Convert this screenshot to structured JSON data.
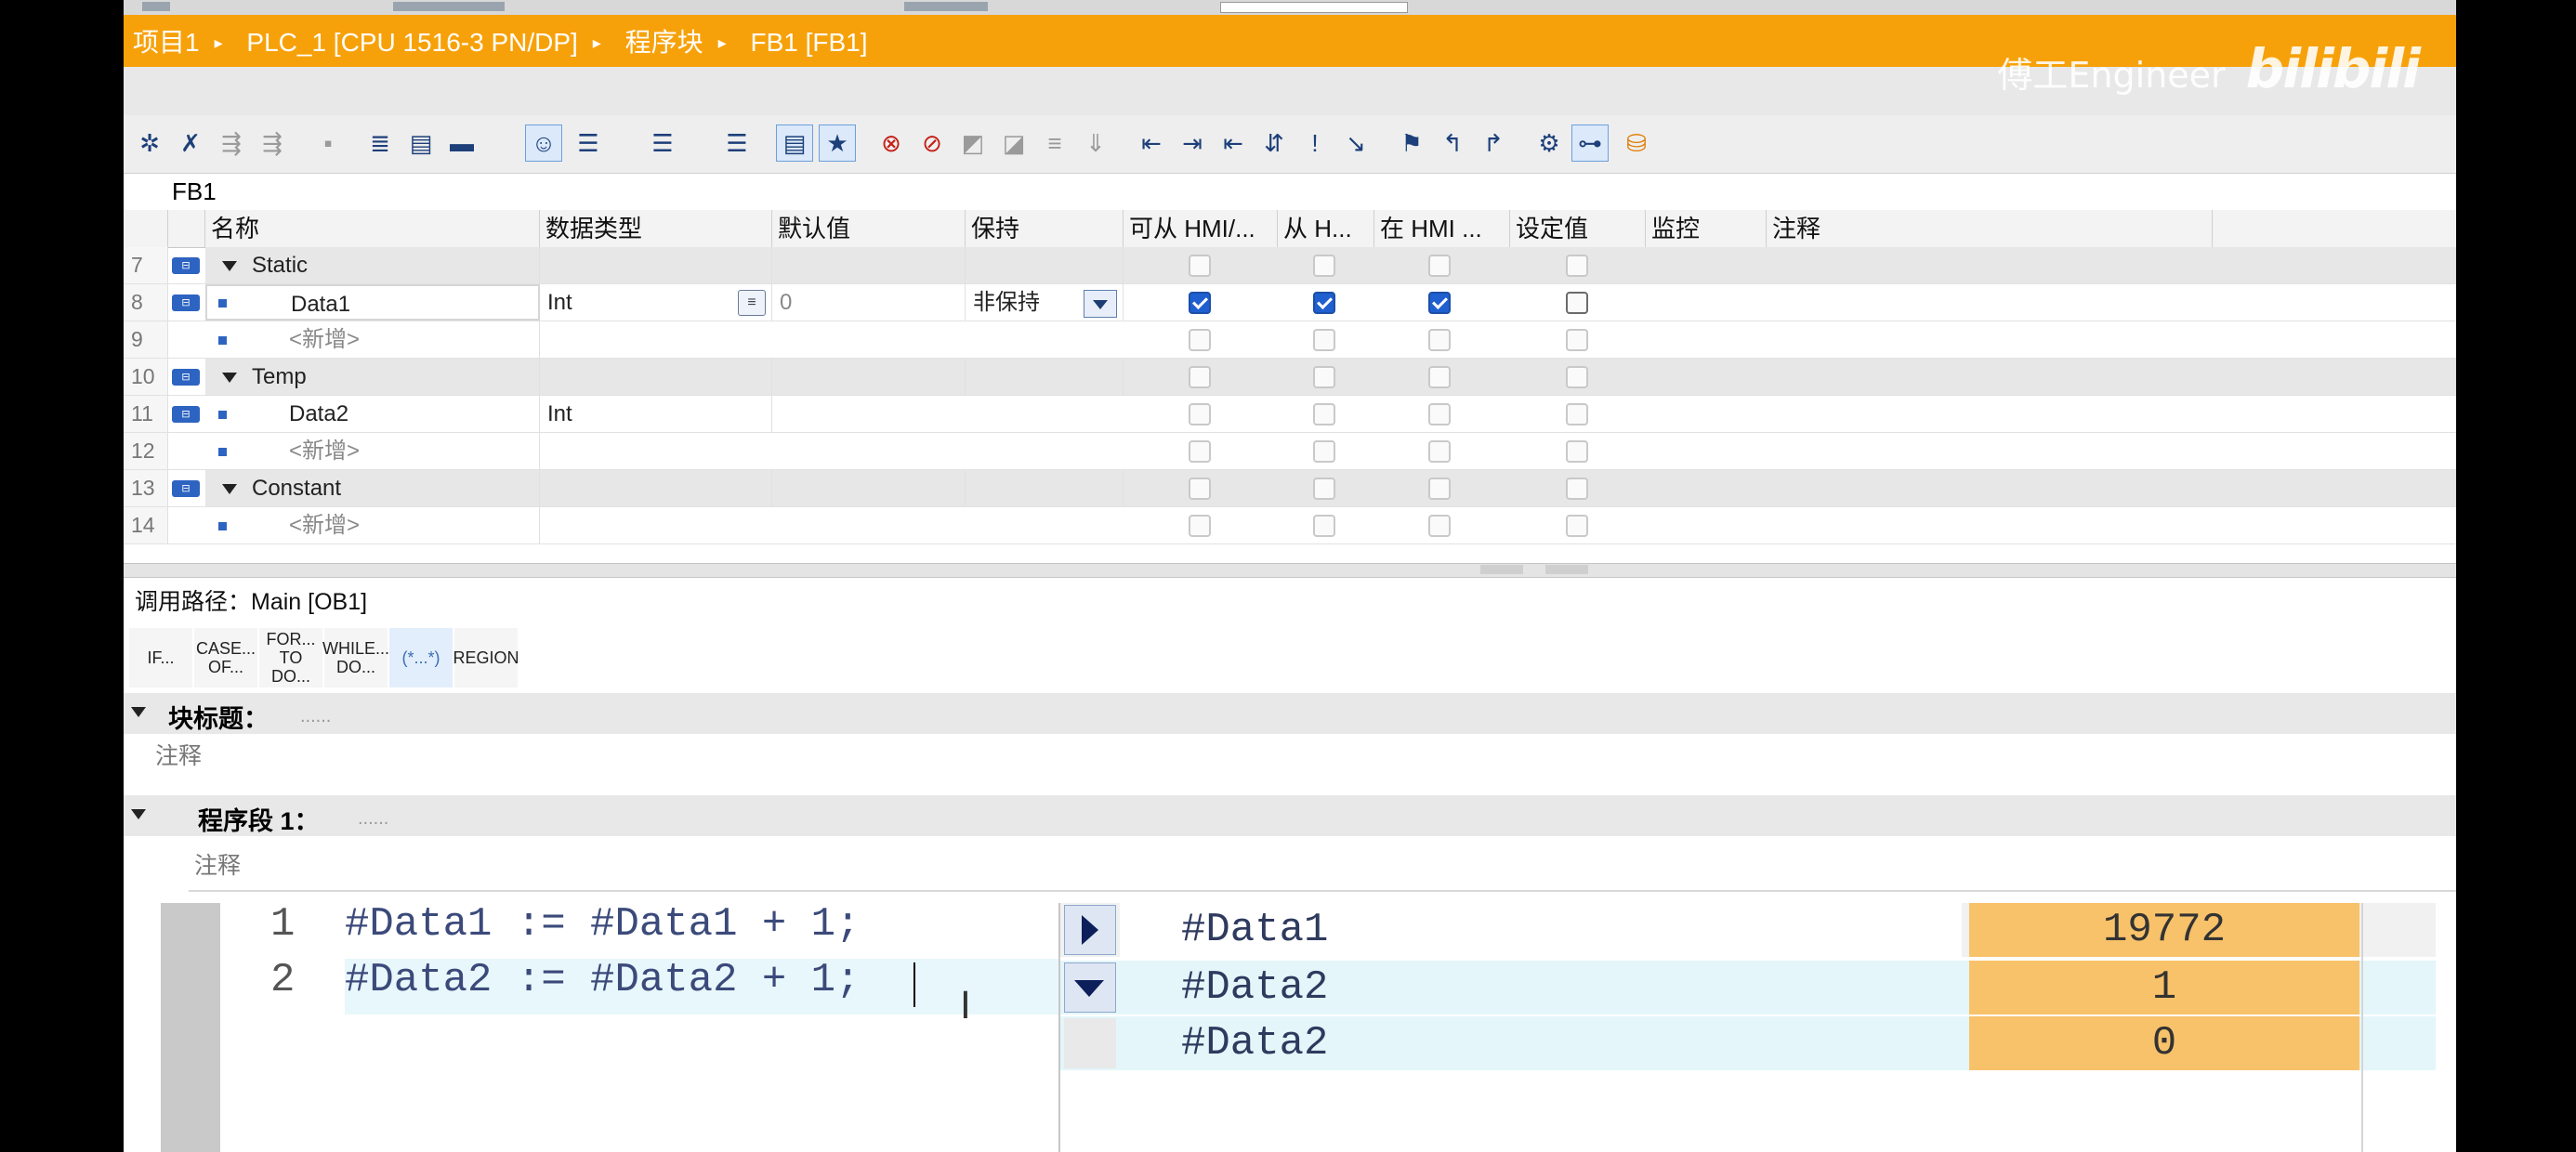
{
  "breadcrumb": {
    "items": [
      "项目1",
      "PLC_1 [CPU 1516-3 PN/DP]",
      "程序块",
      "FB1 [FB1]"
    ],
    "separator": "▸"
  },
  "watermark": {
    "text": "傅工Engineer",
    "logo": "bilibili"
  },
  "block_name": "FB1",
  "interface": {
    "columns": [
      "名称",
      "数据类型",
      "默认值",
      "保持",
      "可从 HMI/...",
      "从 H...",
      "在 HMI ...",
      "设定值",
      "监控",
      "注释"
    ],
    "rows": [
      {
        "num": "7",
        "name": "Static",
        "type": "",
        "default": "",
        "retain": "",
        "section": true,
        "checks": [
          false,
          false,
          false,
          false
        ]
      },
      {
        "num": "8",
        "name": "Data1",
        "type": "Int",
        "default": "0",
        "retain": "非保持",
        "section": false,
        "checks": [
          true,
          true,
          true,
          false
        ]
      },
      {
        "num": "9",
        "name": "<新增>",
        "type": "",
        "default": "",
        "retain": "",
        "section": false,
        "placeholder": true,
        "checks": [
          false,
          false,
          false,
          false
        ]
      },
      {
        "num": "10",
        "name": "Temp",
        "type": "",
        "default": "",
        "retain": "",
        "section": true,
        "checks": [
          false,
          false,
          false,
          false
        ]
      },
      {
        "num": "11",
        "name": "Data2",
        "type": "Int",
        "default": "",
        "retain": "",
        "section": false,
        "checks": [
          false,
          false,
          false,
          false
        ]
      },
      {
        "num": "12",
        "name": "<新增>",
        "type": "",
        "default": "",
        "retain": "",
        "section": false,
        "placeholder": true,
        "checks": [
          false,
          false,
          false,
          false
        ]
      },
      {
        "num": "13",
        "name": "Constant",
        "type": "",
        "default": "",
        "retain": "",
        "section": true,
        "checks": [
          false,
          false,
          false,
          false
        ]
      },
      {
        "num": "14",
        "name": "<新增>",
        "type": "",
        "default": "",
        "retain": "",
        "section": false,
        "placeholder": true,
        "checks": [
          false,
          false,
          false,
          false
        ]
      }
    ]
  },
  "call_path": {
    "label": "调用路径：",
    "value": "Main [OB1]"
  },
  "keywords": [
    "IF...",
    "CASE... OF...",
    "FOR... TO DO...",
    "WHILE... DO...",
    "(*...*)",
    "REGION"
  ],
  "block_title": {
    "label": "块标题：",
    "dots": "......",
    "comment": "注释"
  },
  "network": {
    "label": "程序段 1：",
    "dots": "......",
    "comment": "注释"
  },
  "code": [
    {
      "num": "1",
      "text": "#Data1 := #Data1 + 1;"
    },
    {
      "num": "2",
      "text": "#Data2 := #Data2 + 1;"
    }
  ],
  "monitor": [
    {
      "name": "#Data1",
      "value": "19772",
      "button": "expand"
    },
    {
      "name": "#Data2",
      "value": "1",
      "button": "collapse"
    },
    {
      "name": "#Data2",
      "value": "0",
      "button": ""
    }
  ],
  "colors": {
    "title_bar": "#f7a10a",
    "monitor_value": "#f8c26a",
    "checkbox_on": "#1f5fcf"
  }
}
